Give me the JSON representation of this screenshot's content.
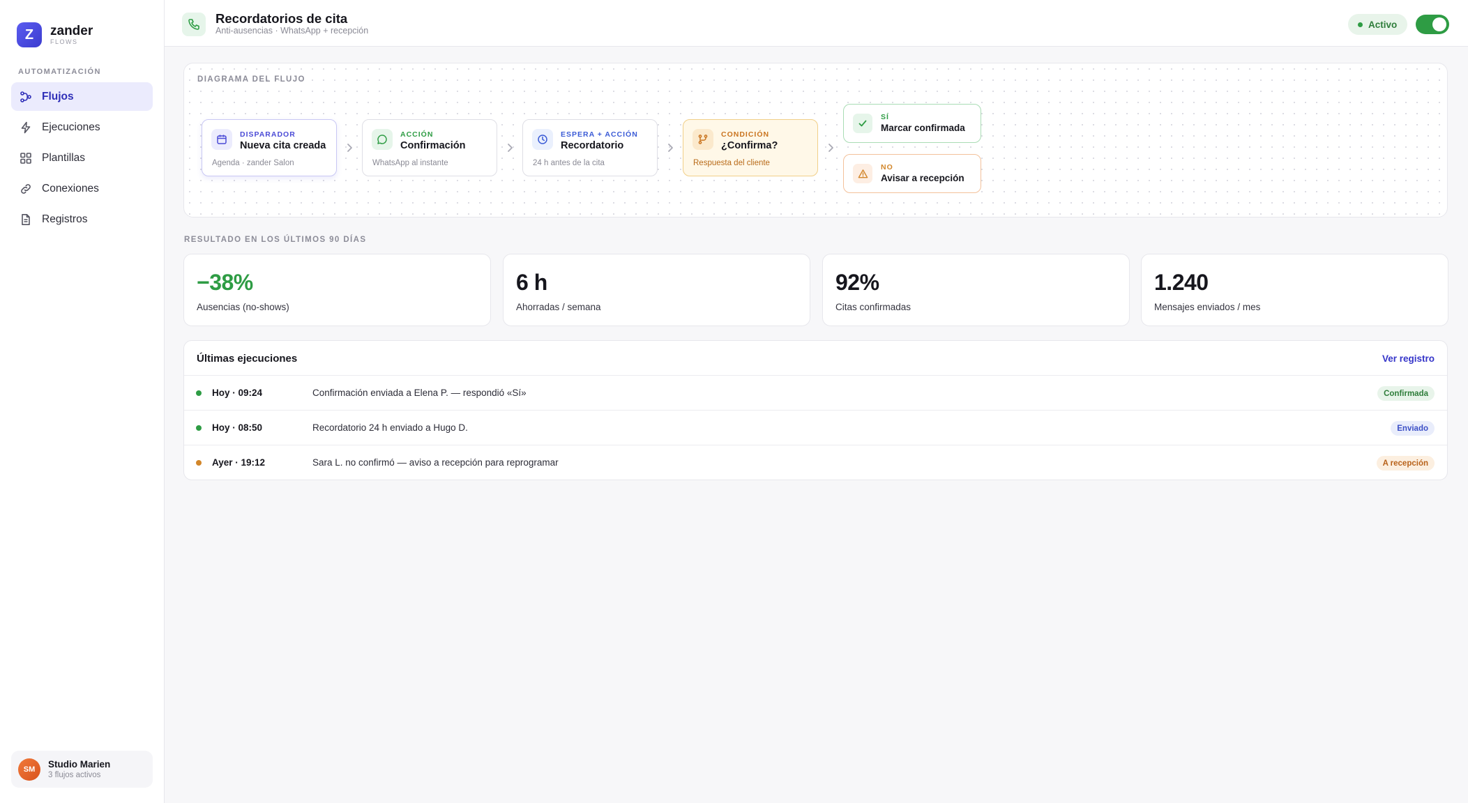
{
  "brand": {
    "initial": "Z",
    "name": "zander",
    "sub": "FLOWS"
  },
  "sidebar": {
    "section": "AUTOMATIZACIÓN",
    "items": [
      {
        "label": "Flujos",
        "icon": "flow-icon",
        "active": true
      },
      {
        "label": "Ejecuciones",
        "icon": "bolt-icon",
        "active": false
      },
      {
        "label": "Plantillas",
        "icon": "grid-icon",
        "active": false
      },
      {
        "label": "Conexiones",
        "icon": "link-icon",
        "active": false
      },
      {
        "label": "Registros",
        "icon": "document-icon",
        "active": false
      }
    ],
    "account": {
      "initials": "SM",
      "name": "Studio Marien",
      "sub": "3 flujos activos"
    }
  },
  "header": {
    "title": "Recordatorios de cita",
    "subtitle": "Anti-ausencias · WhatsApp + recepción",
    "status": "Activo",
    "toggle_on": true
  },
  "flow": {
    "label": "DIAGRAMA DEL FLUJO",
    "nodes": [
      {
        "kicker": "DISPARADOR",
        "title": "Nueva cita creada",
        "foot": "Agenda · zander Salon",
        "icon": "calendar-icon"
      },
      {
        "kicker": "ACCIÓN",
        "title": "Confirmación",
        "foot": "WhatsApp al instante",
        "icon": "chat-icon"
      },
      {
        "kicker": "ESPERA + ACCIÓN",
        "title": "Recordatorio",
        "foot": "24 h antes de la cita",
        "icon": "clock-icon"
      },
      {
        "kicker": "CONDICIÓN",
        "title": "¿Confirma?",
        "foot": "Respuesta del cliente",
        "icon": "branch-icon"
      }
    ],
    "branches": {
      "yes": {
        "kicker": "SÍ",
        "title": "Marcar confirmada",
        "icon": "check-icon"
      },
      "no": {
        "kicker": "NO",
        "title": "Avisar a recepción",
        "icon": "warning-icon"
      }
    }
  },
  "results": {
    "label": "RESULTADO EN LOS ÚLTIMOS 90 DÍAS",
    "stats": [
      {
        "value": "−38%",
        "label": "Ausencias (no-shows)"
      },
      {
        "value": "6 h",
        "label": "Ahorradas / semana"
      },
      {
        "value": "92%",
        "label": "Citas confirmadas"
      },
      {
        "value": "1.240",
        "label": "Mensajes enviados / mes"
      }
    ]
  },
  "executions": {
    "title": "Últimas ejecuciones",
    "link": "Ver registro",
    "rows": [
      {
        "time": "Hoy · 09:24",
        "text": "Confirmación enviada a Elena P. — respondió «Sí»",
        "badge": "Confirmada"
      },
      {
        "time": "Hoy · 08:50",
        "text": "Recordatorio 24 h enviado a Hugo D.",
        "badge": "Enviado"
      },
      {
        "time": "Ayer · 19:12",
        "text": "Sara L. no confirmó — aviso a recepción para reprogramar",
        "badge": "A recepción"
      }
    ]
  },
  "colors": {
    "accent": "#3535c9",
    "success": "#2e9c44",
    "warning": "#d2862a",
    "info": "#3b5bd6"
  }
}
